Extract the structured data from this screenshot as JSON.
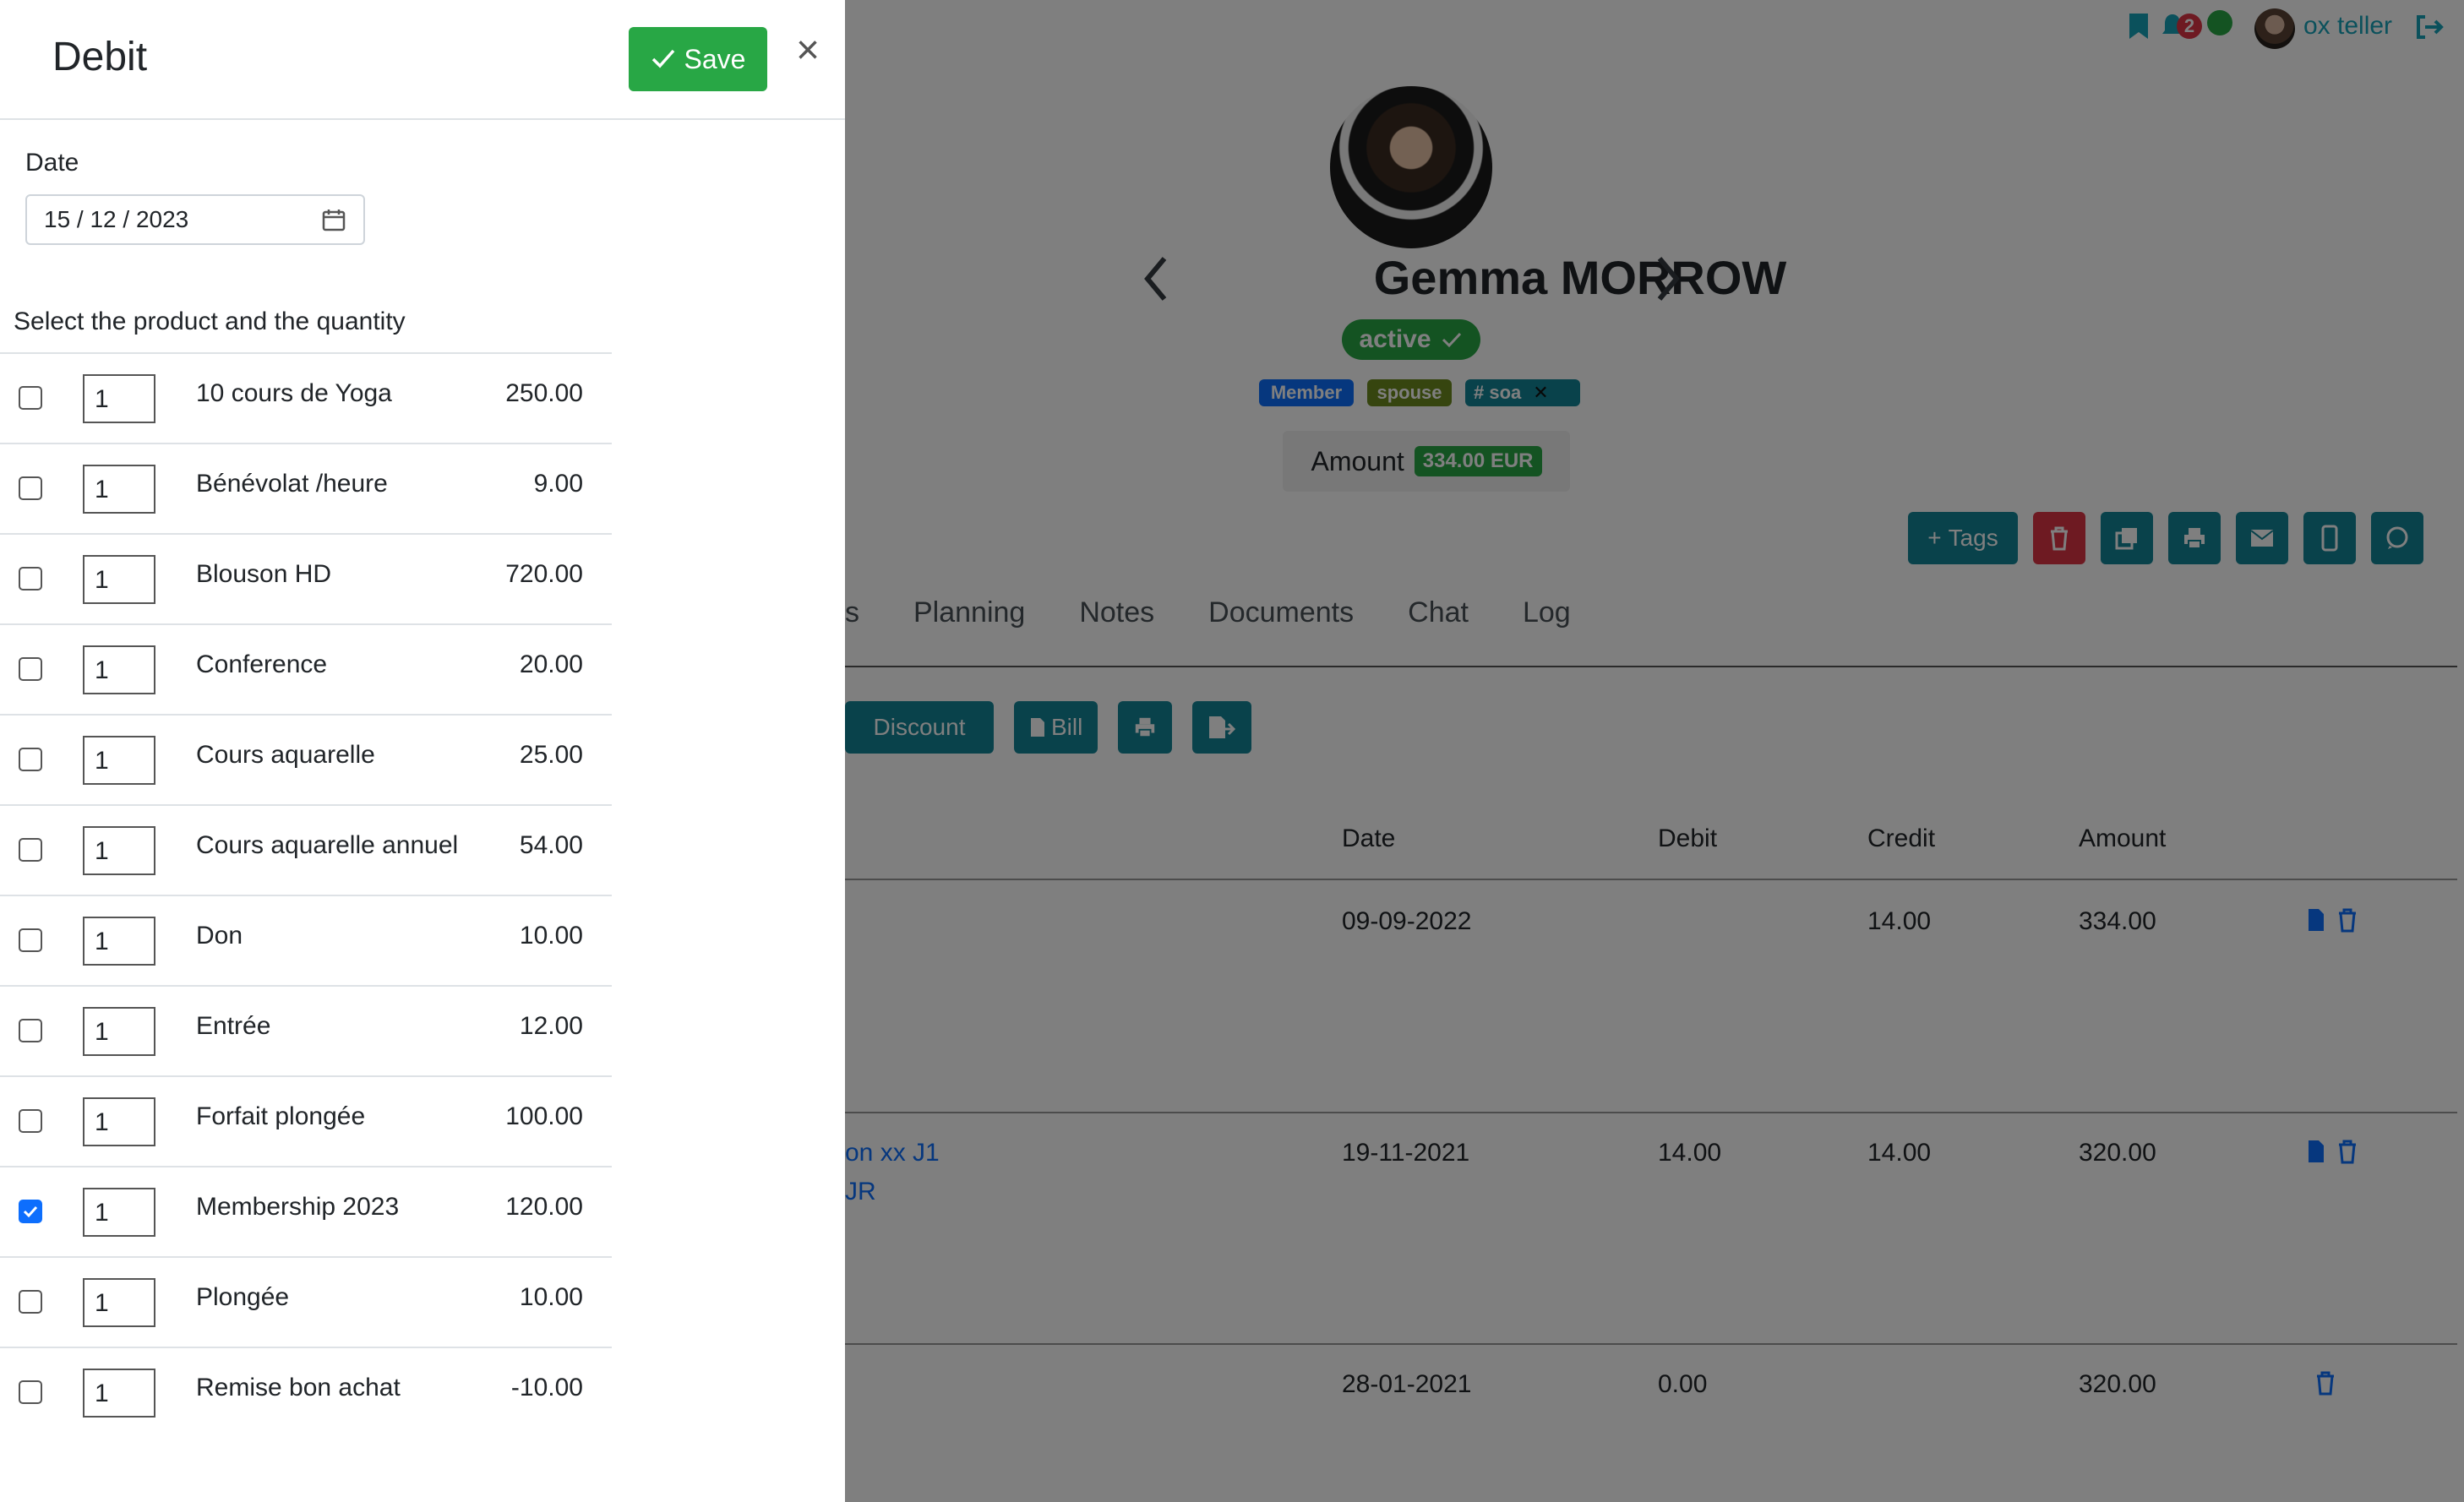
{
  "panel": {
    "title": "Debit",
    "save_label": "Save",
    "close_label": "×",
    "date_label": "Date",
    "date_value": "15 / 12 / 2023",
    "select_label": "Select the product and the quantity",
    "products": [
      {
        "name": "10 cours de Yoga",
        "qty": "1",
        "price": "250.00",
        "checked": false
      },
      {
        "name": "Bénévolat /heure",
        "qty": "1",
        "price": "9.00",
        "checked": false
      },
      {
        "name": "Blouson HD",
        "qty": "1",
        "price": "720.00",
        "checked": false
      },
      {
        "name": "Conference",
        "qty": "1",
        "price": "20.00",
        "checked": false
      },
      {
        "name": "Cours aquarelle",
        "qty": "1",
        "price": "25.00",
        "checked": false
      },
      {
        "name": "Cours aquarelle annuel",
        "qty": "1",
        "price": "54.00",
        "checked": false
      },
      {
        "name": "Don",
        "qty": "1",
        "price": "10.00",
        "checked": false
      },
      {
        "name": "Entrée",
        "qty": "1",
        "price": "12.00",
        "checked": false
      },
      {
        "name": "Forfait plongée",
        "qty": "1",
        "price": "100.00",
        "checked": false
      },
      {
        "name": "Membership 2023",
        "qty": "1",
        "price": "120.00",
        "checked": true
      },
      {
        "name": "Plongée",
        "qty": "1",
        "price": "10.00",
        "checked": false
      },
      {
        "name": "Remise bon achat",
        "qty": "1",
        "price": "-10.00",
        "checked": false
      }
    ]
  },
  "header": {
    "notification_count": "2",
    "user_name": "ox teller"
  },
  "profile": {
    "name": "Gemma MORROW",
    "status": "active",
    "tags": [
      "Member",
      "spouse",
      "# soa"
    ],
    "amount_label": "Amount",
    "amount_value": "334.00 EUR"
  },
  "toolbar": {
    "tags_label": "Tags"
  },
  "tabs": [
    "s",
    "Planning",
    "Notes",
    "Documents",
    "Chat",
    "Log"
  ],
  "actions": {
    "discount_label": "Discount",
    "bill_label": "Bill"
  },
  "table": {
    "headers": [
      "Date",
      "Debit",
      "Credit",
      "Amount"
    ],
    "rows": [
      {
        "desc1": "",
        "desc2": "",
        "date": "09-09-2022",
        "debit": "",
        "credit": "14.00",
        "amount": "334.00"
      },
      {
        "desc1": "on xx J1",
        "desc2": "JR",
        "date": "19-11-2021",
        "debit": "14.00",
        "credit": "14.00",
        "amount": "320.00"
      },
      {
        "desc1": "",
        "desc2": "",
        "date": "28-01-2021",
        "debit": "0.00",
        "credit": "",
        "amount": "320.00"
      }
    ]
  },
  "colors": {
    "primary": "#138496",
    "success": "#28a745",
    "danger": "#dc3545",
    "link": "#0d6efd"
  }
}
